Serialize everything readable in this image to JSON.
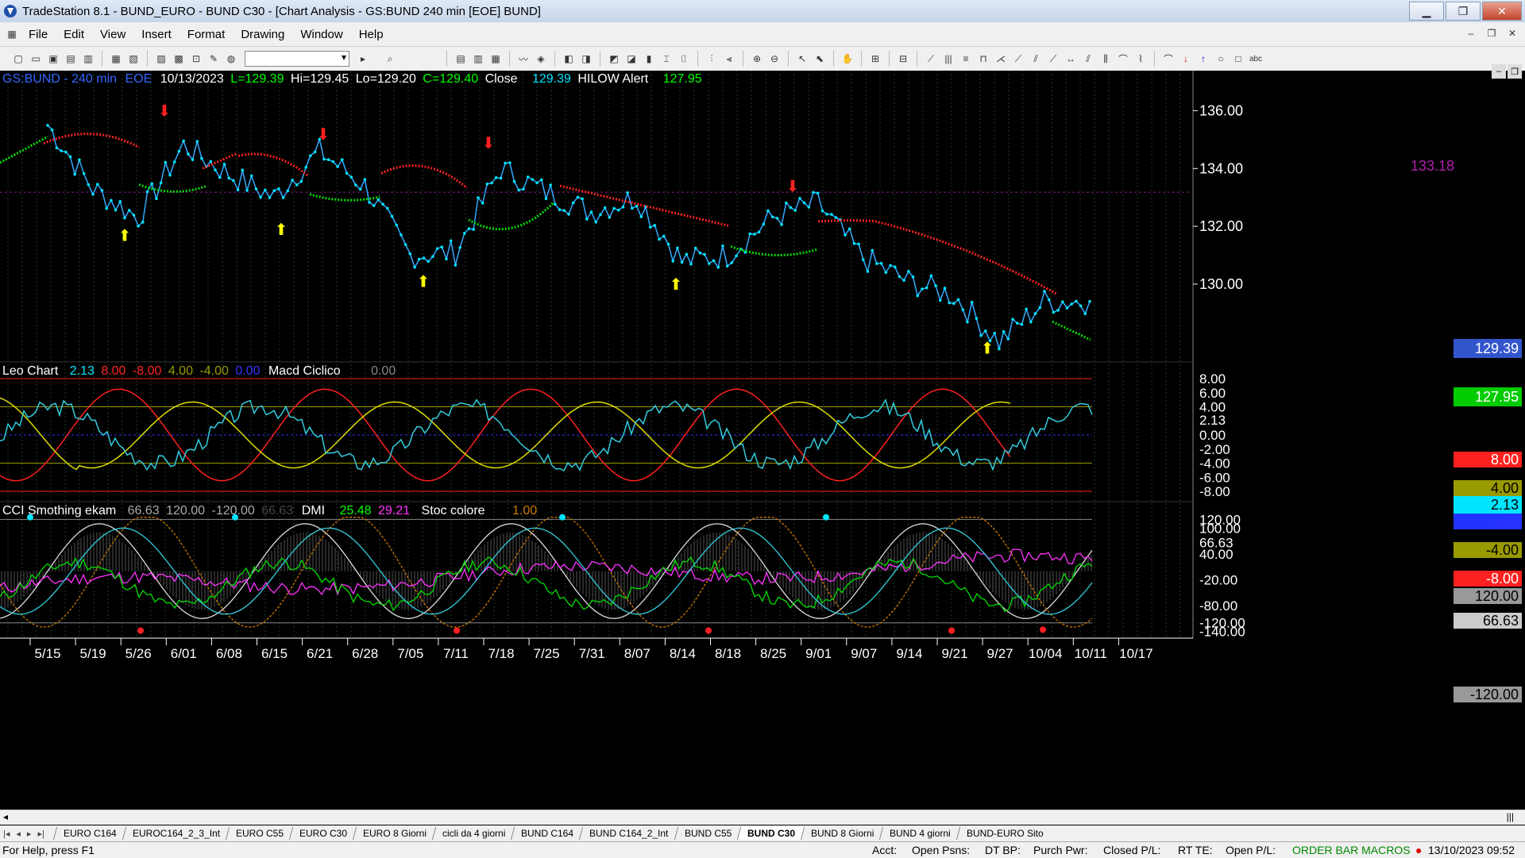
{
  "window": {
    "title": "TradeStation 8.1 - BUND_EURO - BUND  C30 - [Chart Analysis - GS:BUND  240 min  [EOE] BUND]"
  },
  "menu": [
    "File",
    "Edit",
    "View",
    "Insert",
    "Format",
    "Drawing",
    "Window",
    "Help"
  ],
  "header": {
    "symbol": "GS:BUND - 240 min",
    "exch": "EOE",
    "date": "10/13/2023",
    "low": "L=129.39",
    "high": "Hi=129.45",
    "lo": "Lo=129.20",
    "close": "C=129.40",
    "close_label": "Close",
    "close_val": "129.39",
    "alert": "HILOW Alert",
    "alert_val": "127.95"
  },
  "price_axis": [
    "136.00",
    "134.00",
    "132.00",
    "130.00"
  ],
  "price_marker": "133.18",
  "price_boxes": {
    "last": "129.39",
    "alert": "127.95"
  },
  "panel2": {
    "title": "Leo Chart",
    "v1": "2.13",
    "v2": "8.00",
    "v3": "-8.00",
    "v4": "4.00",
    "v5": "-4.00",
    "v6": "0.00",
    "title2": "Macd Ciclico",
    "v7": "0.00",
    "axis": [
      "8.00",
      "6.00",
      "4.00",
      "2.13",
      "0.00",
      "-2.00",
      "-4.00",
      "-6.00",
      "-8.00"
    ]
  },
  "panel3": {
    "title": "CCI Smothing ekam",
    "v1": "66.63",
    "v2": "120.00",
    "v3": "-120.00",
    "v4": "66.63",
    "title2": "DMI",
    "v5": "25.48",
    "v6": "29.21",
    "title3": "Stoc colore",
    "v7": "1.00",
    "axis": [
      "120.00",
      "100.00",
      "66.63",
      "40.00",
      "-20.00",
      "-80.00",
      "-120.00",
      "-140.00"
    ]
  },
  "dates": [
    "5/15",
    "5/19",
    "5/26",
    "6/01",
    "6/08",
    "6/15",
    "6/21",
    "6/28",
    "7/05",
    "7/11",
    "7/18",
    "7/25",
    "7/31",
    "8/07",
    "8/14",
    "8/18",
    "8/25",
    "9/01",
    "9/07",
    "9/14",
    "9/21",
    "9/27",
    "10/04",
    "10/11",
    "10/17"
  ],
  "tabs": [
    "EURO C164",
    "EUROC164_2_3_Int",
    "EURO C55",
    "EURO C30",
    "EURO 8 Giorni",
    "cicli da 4 giorni",
    "BUND C164",
    "BUND C164_2_Int",
    "BUND C55",
    "BUND  C30",
    "BUND 8 Giorni",
    "BUND 4 giorni",
    "BUND-EURO Sito"
  ],
  "active_tab": "BUND  C30",
  "status": {
    "help": "For Help, press F1",
    "acct": "Acct:",
    "psns": "Open Psns:",
    "dtbp": "DT BP:",
    "purch": "Purch Pwr:",
    "closed": "Closed P/L:",
    "rtte": "RT TE:",
    "openpl": "Open P/L:",
    "macros": "ORDER BAR  MACROS",
    "datetime": "13/10/2023 09:52"
  },
  "chart_data": {
    "type": "line",
    "x": [
      "5/15",
      "5/19",
      "5/26",
      "6/01",
      "6/08",
      "6/15",
      "6/21",
      "6/28",
      "7/05",
      "7/11",
      "7/18",
      "7/25",
      "7/31",
      "8/07",
      "8/14",
      "8/18",
      "8/25",
      "9/01",
      "9/07",
      "9/14",
      "9/21",
      "9/27",
      "10/04",
      "10/11"
    ],
    "series": [
      {
        "name": "Close",
        "values": [
          135.5,
          133.3,
          132.3,
          134.8,
          133.8,
          133.0,
          134.6,
          133.4,
          131.0,
          131.1,
          134.0,
          133.2,
          132.5,
          133.0,
          130.8,
          131.0,
          132.3,
          132.8,
          130.9,
          130.1,
          129.6,
          128.0,
          129.4,
          129.4
        ]
      }
    ],
    "ylim": [
      127.5,
      137
    ]
  }
}
